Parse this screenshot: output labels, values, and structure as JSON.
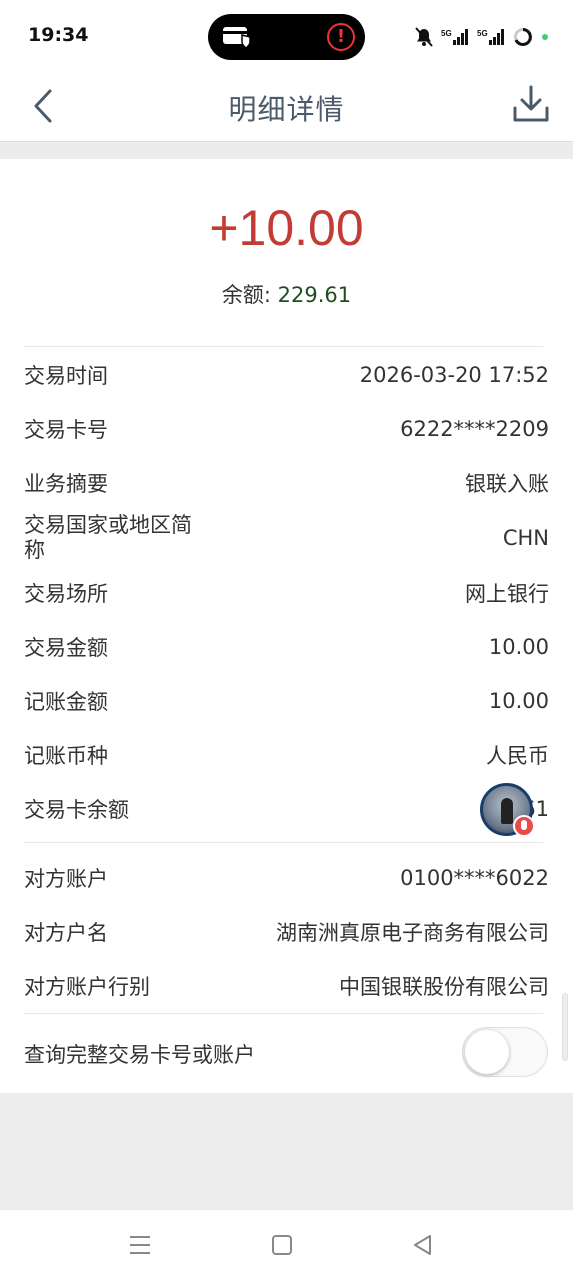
{
  "status_bar": {
    "time": "19:34",
    "signal_a": "5G",
    "signal_b": "5G"
  },
  "header": {
    "title": "明细详情"
  },
  "summary": {
    "amount": "+10.00",
    "balance_label": "余额:",
    "balance_value": "229.61",
    "amount_color": "#c33b35"
  },
  "details": [
    {
      "label": "交易时间",
      "value": "2026-03-20 17:52"
    },
    {
      "label": "交易卡号",
      "value": "6222****2209"
    },
    {
      "label": "业务摘要",
      "value": "银联入账"
    },
    {
      "label": "交易国家或地区简称",
      "value": "CHN"
    },
    {
      "label": "交易场所",
      "value": "网上银行"
    },
    {
      "label": "交易金额",
      "value": "10.00"
    },
    {
      "label": "记账金额",
      "value": "10.00"
    },
    {
      "label": "记账币种",
      "value": "人民币"
    },
    {
      "label": "交易卡余额",
      "value": "61"
    }
  ],
  "counterparty": [
    {
      "label": "对方账户",
      "value": "0100****6022"
    },
    {
      "label": "对方户名",
      "value": "湖南洲真原电子商务有限公司"
    },
    {
      "label": "对方账户行别",
      "value": "中国银联股份有限公司"
    }
  ],
  "toggle": {
    "label": "查询完整交易卡号或账户",
    "on": false
  }
}
